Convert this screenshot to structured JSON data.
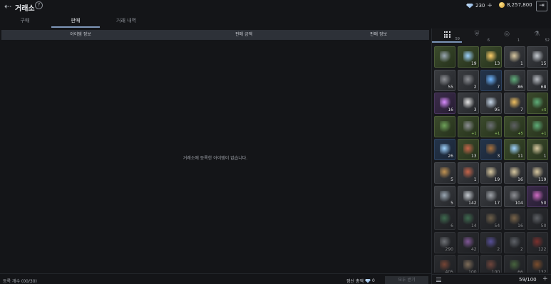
{
  "header": {
    "title": "거래소",
    "help_label": "?",
    "diamond_amount": "230",
    "gold_amount": "8,257,800",
    "plus_label": "+"
  },
  "tabs": [
    {
      "label": "구매"
    },
    {
      "label": "판매"
    },
    {
      "label": "거래 내역"
    }
  ],
  "active_tab": "판매",
  "table": {
    "columns": [
      "아이템 정보",
      "판매 금액",
      "판매 정보"
    ],
    "empty_message": "거래소에 등록한 아이템이 없습니다."
  },
  "footer": {
    "registration_count": "등록 개수 (00/30)",
    "settlement_label": "정산 총액",
    "settlement_amount": "0",
    "collect_all_button": "모두 받기"
  },
  "inventory": {
    "tabs": [
      {
        "icon": "grid-icon",
        "count": "59"
      },
      {
        "icon": "armor-icon",
        "count": "6"
      },
      {
        "icon": "accessory-icon",
        "count": "1"
      },
      {
        "icon": "material-icon",
        "count": "52"
      }
    ],
    "capacity": "59/100",
    "items": [
      {
        "icon": "axe-icon",
        "grade": "green",
        "qty": ""
      },
      {
        "icon": "crystal-icon",
        "grade": "green",
        "qty": "19"
      },
      {
        "icon": "orb-icon",
        "grade": "green",
        "qty": "13"
      },
      {
        "icon": "scroll-icon",
        "grade": "gray",
        "qty": "1"
      },
      {
        "icon": "dagger-icon",
        "grade": "gray",
        "qty": "15"
      },
      {
        "icon": "helmet-icon",
        "grade": "gray",
        "qty": "55"
      },
      {
        "icon": "helmet-icon",
        "grade": "gray",
        "qty": "2"
      },
      {
        "icon": "gem-icon",
        "grade": "blue",
        "qty": "7"
      },
      {
        "icon": "herb-icon",
        "grade": "gray",
        "qty": "86"
      },
      {
        "icon": "ingot-icon",
        "grade": "gray",
        "qty": "68"
      },
      {
        "icon": "amethyst-icon",
        "grade": "purple",
        "qty": "16"
      },
      {
        "icon": "rune-icon",
        "grade": "gray",
        "qty": "3"
      },
      {
        "icon": "stone-icon",
        "grade": "gray",
        "qty": "95"
      },
      {
        "icon": "charm-icon",
        "grade": "gray",
        "qty": "7"
      },
      {
        "icon": "herb-icon",
        "grade": "green",
        "qty": "+5"
      },
      {
        "icon": "leaf-icon",
        "grade": "green",
        "qty": ""
      },
      {
        "icon": "helmet-icon",
        "grade": "green",
        "qty": "+1"
      },
      {
        "icon": "armor-icon",
        "grade": "green",
        "qty": "+1"
      },
      {
        "icon": "boots-icon",
        "grade": "green",
        "qty": "+5"
      },
      {
        "icon": "herb-icon",
        "grade": "green",
        "qty": "+1"
      },
      {
        "icon": "crystal-icon",
        "grade": "blue",
        "qty": "26"
      },
      {
        "icon": "spear-icon",
        "grade": "green",
        "qty": "13"
      },
      {
        "icon": "shield-icon",
        "grade": "blue",
        "qty": "3"
      },
      {
        "icon": "crystal-icon",
        "grade": "green",
        "qty": "11"
      },
      {
        "icon": "scroll-icon",
        "grade": "green",
        "qty": "1"
      },
      {
        "icon": "book-icon",
        "grade": "gray",
        "qty": "5"
      },
      {
        "icon": "spear-icon",
        "grade": "gray",
        "qty": "1"
      },
      {
        "icon": "scroll-icon",
        "grade": "gray",
        "qty": "19"
      },
      {
        "icon": "scroll-icon",
        "grade": "gray",
        "qty": "16"
      },
      {
        "icon": "scroll-icon",
        "grade": "gray",
        "qty": "119"
      },
      {
        "icon": "axe-icon",
        "grade": "gray",
        "qty": "5"
      },
      {
        "icon": "dagger-icon",
        "grade": "gray",
        "qty": "142"
      },
      {
        "icon": "claw-icon",
        "grade": "gray",
        "qty": "17"
      },
      {
        "icon": "helmet-icon",
        "grade": "gray",
        "qty": "104"
      },
      {
        "icon": "flower-icon",
        "grade": "purple",
        "qty": "50"
      },
      {
        "icon": "herb-icon",
        "grade": "dim",
        "qty": "6"
      },
      {
        "icon": "herb-icon",
        "grade": "dim",
        "qty": "14"
      },
      {
        "icon": "staff-icon",
        "grade": "dim",
        "qty": "54"
      },
      {
        "icon": "wand-icon",
        "grade": "dim",
        "qty": "16"
      },
      {
        "icon": "ore-icon",
        "grade": "dim",
        "qty": "50"
      },
      {
        "icon": "ingot-icon",
        "grade": "dim",
        "qty": "290"
      },
      {
        "icon": "amethyst-icon",
        "grade": "dim",
        "qty": "42"
      },
      {
        "icon": "cluster-icon",
        "grade": "dim",
        "qty": "2"
      },
      {
        "icon": "shard-icon",
        "grade": "dim",
        "qty": "2"
      },
      {
        "icon": "potion-icon",
        "grade": "dim",
        "qty": "122"
      },
      {
        "icon": "quill-icon",
        "grade": "dim",
        "qty": "405"
      },
      {
        "icon": "pouch-icon",
        "grade": "dim",
        "qty": "100"
      },
      {
        "icon": "food-icon",
        "grade": "dim",
        "qty": "100"
      },
      {
        "icon": "leaf-icon",
        "grade": "dim",
        "qty": "66"
      },
      {
        "icon": "hide-icon",
        "grade": "dim",
        "qty": "132"
      }
    ]
  },
  "colors": {
    "background": "#141518",
    "accent": "#7f97b9",
    "panel_header": "#2d3138"
  }
}
